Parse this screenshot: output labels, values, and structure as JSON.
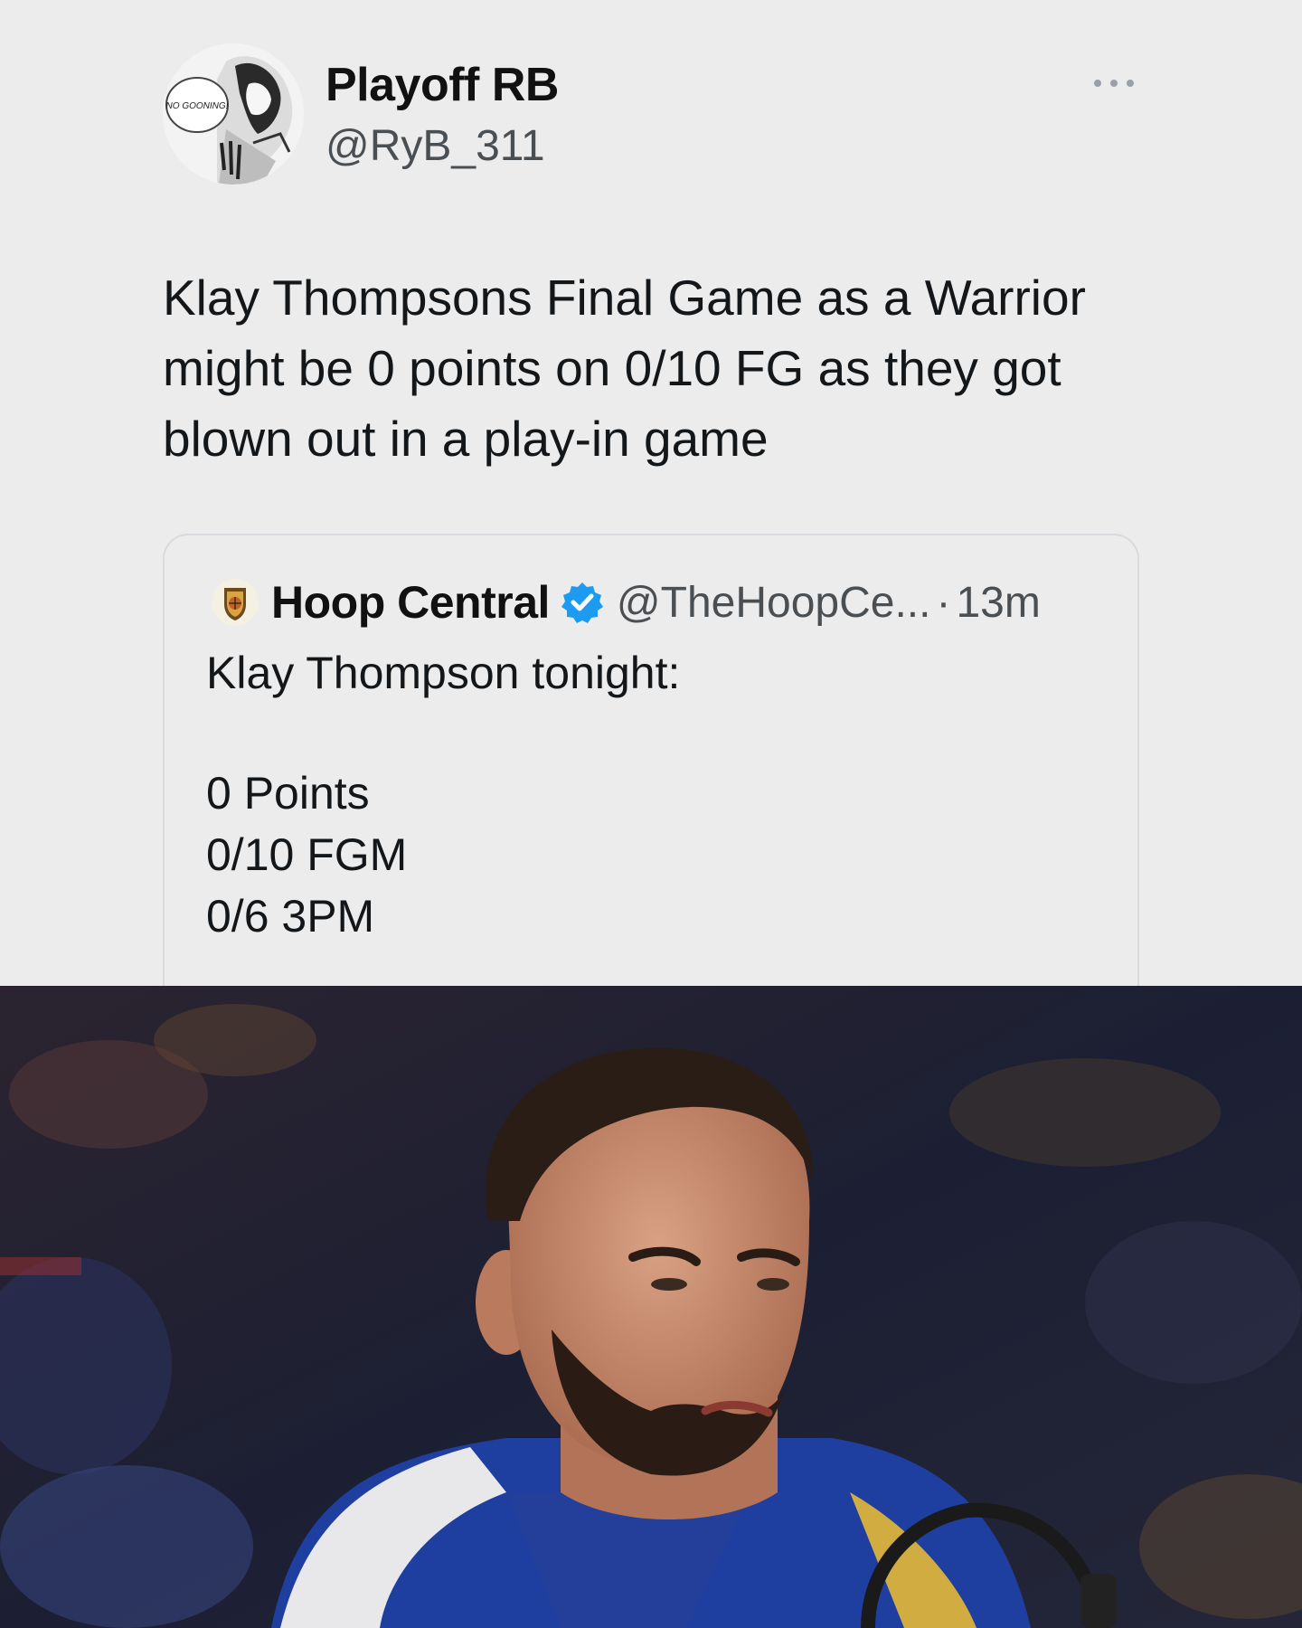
{
  "tweet": {
    "display_name": "Playoff RB",
    "handle": "@RyB_311",
    "text": "Klay Thompsons Final Game as a Warrior might be 0 points on 0/10 FG as they got blown out in a play-in game",
    "avatar_caption": "NO GOONING!",
    "more_icon": "more-horizontal-icon"
  },
  "quoted_tweet": {
    "display_name": "Hoop Central",
    "verified_icon": "verified-badge-icon",
    "handle": "@TheHoopCe...",
    "separator": "·",
    "time": "13m",
    "lines": [
      "Klay Thompson tonight:",
      "0 Points",
      "0/10 FGM",
      "0/6 3PM"
    ]
  },
  "colors": {
    "background": "#ececec",
    "text": "#14171a",
    "secondary_text": "#4a4f54",
    "verified_blue": "#1d9bf0",
    "card_border": "#d7dbdf"
  }
}
